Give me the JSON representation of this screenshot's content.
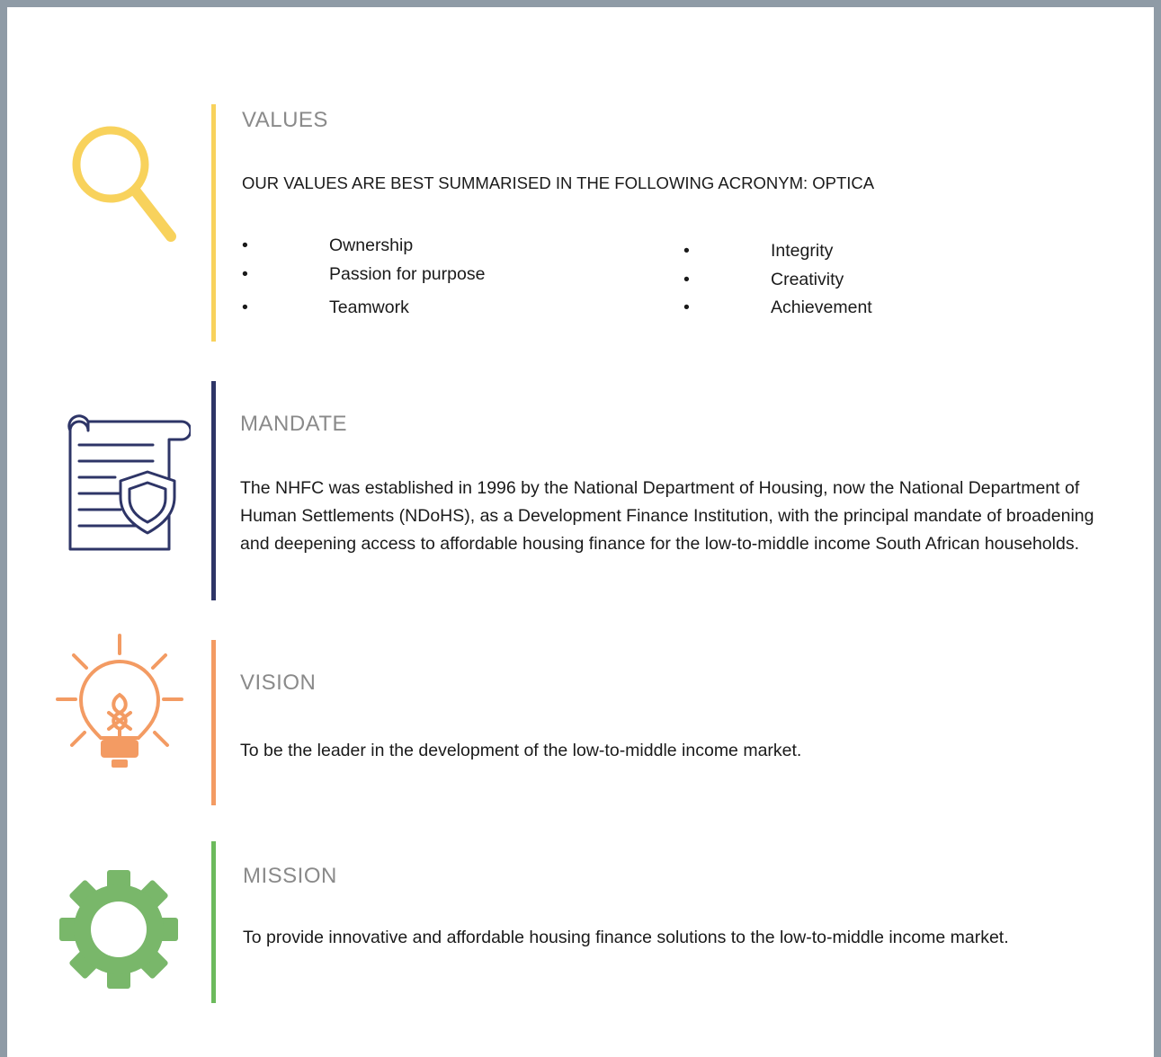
{
  "colors": {
    "values_accent": "#f8d25c",
    "mandate_accent": "#2e3567",
    "vision_accent": "#f39b63",
    "mission_accent": "#6cba5c",
    "frame": "#8f9ba6"
  },
  "values": {
    "icon": "magnifying-glass-icon",
    "title": "VALUES",
    "intro": "OUR VALUES ARE BEST SUMMARISED IN THE FOLLOWING ACRONYM: OPTICA",
    "bullet": "•",
    "items_left": [
      "Ownership",
      "Passion for purpose",
      "Teamwork"
    ],
    "items_right": [
      "Integrity",
      "Creativity",
      "Achievement"
    ]
  },
  "mandate": {
    "icon": "document-shield-icon",
    "title": "MANDATE",
    "body": "The NHFC was established in 1996 by the National Department of Housing, now the National Department of Human Settlements (NDoHS), as a Development Finance Institution, with the principal mandate of broadening and deepening access to affordable housing finance for the low-to-middle income South African households."
  },
  "vision": {
    "icon": "lightbulb-icon",
    "title": "VISION",
    "body": "To be the leader in the development of the low-to-middle income market."
  },
  "mission": {
    "icon": "gear-icon",
    "title": "MISSION",
    "body": "To provide innovative and affordable housing finance solutions to the low-to-middle income market."
  }
}
